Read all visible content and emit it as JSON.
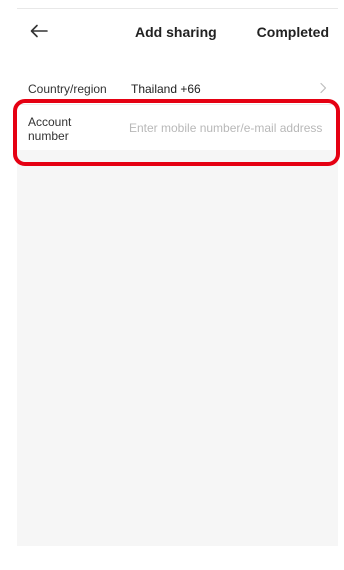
{
  "header": {
    "back_icon": "arrow-left-icon",
    "title": "Add sharing",
    "done_label": "Completed"
  },
  "form": {
    "country": {
      "label": "Country/region",
      "value": "Thailand +66",
      "chevron_icon": "chevron-right-icon"
    },
    "account": {
      "label": "Account number",
      "value": "",
      "placeholder": "Enter mobile number/e-mail address"
    }
  },
  "colors": {
    "highlight": "#e50012",
    "background": "#f6f6f6",
    "row": "#ffffff",
    "placeholder": "#b8b8b8"
  }
}
